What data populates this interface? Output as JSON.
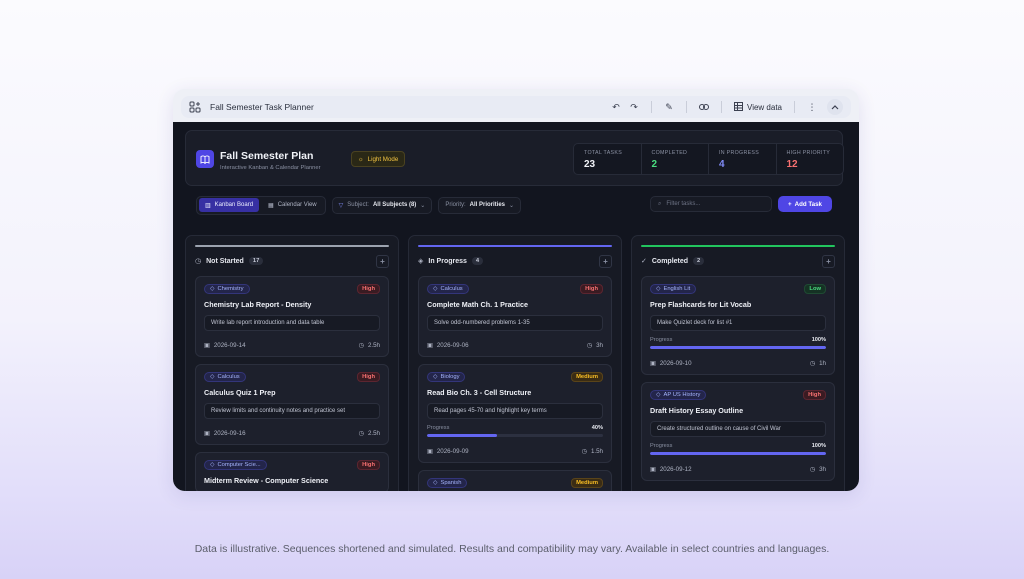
{
  "window": {
    "title": "Fall Semester Task Planner",
    "view_data_label": "View data"
  },
  "header": {
    "title": "Fall Semester Plan",
    "subtitle": "Interactive Kanban & Calendar Planner",
    "theme_toggle": "Light Mode"
  },
  "stats": [
    {
      "label": "TOTAL TASKS",
      "value": "23",
      "color": "#f1f3f8"
    },
    {
      "label": "COMPLETED",
      "value": "2",
      "color": "#4ade80"
    },
    {
      "label": "IN PROGRESS",
      "value": "4",
      "color": "#818cf8"
    },
    {
      "label": "HIGH PRIORITY",
      "value": "12",
      "color": "#f87171"
    }
  ],
  "toolbar": {
    "kanban_label": "Kanban Board",
    "calendar_label": "Calendar View",
    "subject_label": "Subject:",
    "subject_value": "All Subjects (8)",
    "priority_label": "Priority:",
    "priority_value": "All Priorities",
    "search_placeholder": "Filter tasks...",
    "add_label": "Add Task"
  },
  "columns": [
    {
      "title": "Not Started",
      "count": "17",
      "color": "#9ca3af",
      "cards": [
        {
          "tag": "Chemistry",
          "priority": "High",
          "title": "Chemistry Lab Report - Density",
          "desc": "Write lab report introduction and data table",
          "date": "2026-09-14",
          "hours": "2.5h"
        },
        {
          "tag": "Calculus",
          "priority": "High",
          "title": "Calculus Quiz 1 Prep",
          "desc": "Review limits and continuity notes and practice set",
          "date": "2026-09-16",
          "hours": "2.5h"
        },
        {
          "tag": "Computer Scie...",
          "priority": "High",
          "title": "Midterm Review - Computer Science",
          "desc": "",
          "date": "",
          "hours": ""
        }
      ]
    },
    {
      "title": "In Progress",
      "count": "4",
      "color": "#6366f1",
      "cards": [
        {
          "tag": "Calculus",
          "priority": "High",
          "title": "Complete Math Ch. 1 Practice",
          "desc": "Solve odd-numbered problems 1-35",
          "date": "2026-09-06",
          "hours": "3h"
        },
        {
          "tag": "Biology",
          "priority": "Medium",
          "title": "Read Bio Ch. 3 - Cell Structure",
          "desc": "Read pages 45-70 and highlight key terms",
          "progress_label": "Progress",
          "progress": "40%",
          "progress_value": 0.4,
          "date": "2026-09-09",
          "hours": "1.5h"
        },
        {
          "tag": "Spanish",
          "priority": "Medium",
          "title": "",
          "desc": "",
          "date": "",
          "hours": ""
        }
      ]
    },
    {
      "title": "Completed",
      "count": "2",
      "color": "#22c55e",
      "cards": [
        {
          "tag": "English Lit",
          "priority": "Low",
          "title": "Prep Flashcards for Lit Vocab",
          "desc": "Make Quizlet deck for list #1",
          "progress_label": "Progress",
          "progress": "100%",
          "progress_value": 1.0,
          "date": "2026-09-10",
          "hours": "1h"
        },
        {
          "tag": "AP US History",
          "priority": "High",
          "title": "Draft History Essay Outline",
          "desc": "Create structured outline on cause of Civil War",
          "progress_label": "Progress",
          "progress": "100%",
          "progress_value": 1.0,
          "date": "2026-09-12",
          "hours": "3h"
        }
      ]
    }
  ],
  "disclaimer": "Data is illustrative. Sequences shortened and simulated. Results and compatibility may vary. Available in select countries and languages."
}
